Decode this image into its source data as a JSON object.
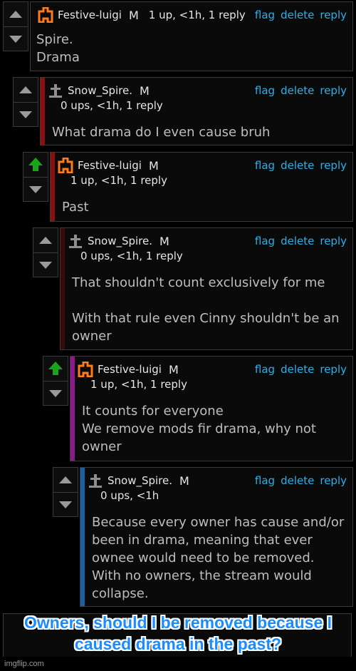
{
  "actions": {
    "flag": "flag",
    "delete": "delete",
    "reply": "reply"
  },
  "comments": [
    {
      "user": "Festive-luigi",
      "badge": "M",
      "meta": "1 up, <1h, 1 reply",
      "text": "Spire.\nDrama",
      "avatar": "festive-avatar-icon",
      "voted": false,
      "bar_color": ""
    },
    {
      "user": "Snow_Spire.",
      "badge": "M",
      "meta": "0 ups, <1h, 1 reply",
      "text": "What drama do I even cause bruh",
      "avatar": "grave-avatar-icon",
      "voted": false,
      "bar_color": "#8b0f0f"
    },
    {
      "user": "Festive-luigi",
      "badge": "M",
      "meta": "1 up, <1h, 1 reply",
      "text": "Past",
      "avatar": "festive-avatar-icon",
      "voted": true,
      "bar_color": "#8b0f0f"
    },
    {
      "user": "Snow_Spire.",
      "badge": "M",
      "meta": "0 ups, <1h, 1 reply",
      "text": "That shouldn't count exclusively for me\n\nWith that rule even Cinny shouldn't be an owner",
      "avatar": "grave-avatar-icon",
      "voted": false,
      "bar_color": "#3a0a0a"
    },
    {
      "user": "Festive-luigi",
      "badge": "M",
      "meta": "1 up, <1h, 1 reply",
      "text": "It counts for everyone\nWe remove mods fir drama, why not owner",
      "avatar": "festive-avatar-icon",
      "voted": true,
      "bar_color": "#8d1a8d"
    },
    {
      "user": "Snow_Spire.",
      "badge": "M",
      "meta": "0 ups, <1h",
      "text": "Because every owner has cause and/or been in drama, meaning that ever ownee would need to be removed. With no owners, the stream would collapse.",
      "avatar": "grave-avatar-icon",
      "voted": false,
      "bar_color": "#1a5ea8"
    }
  ],
  "caption": "Owners, should I be removed because I caused drama in the past?",
  "footer": "imgflip.com",
  "colors": {
    "link": "#2bb0e8",
    "upvote": "#18a51a",
    "festive_orange": "#ff7a1a",
    "caption_blue": "#1a8cff"
  }
}
